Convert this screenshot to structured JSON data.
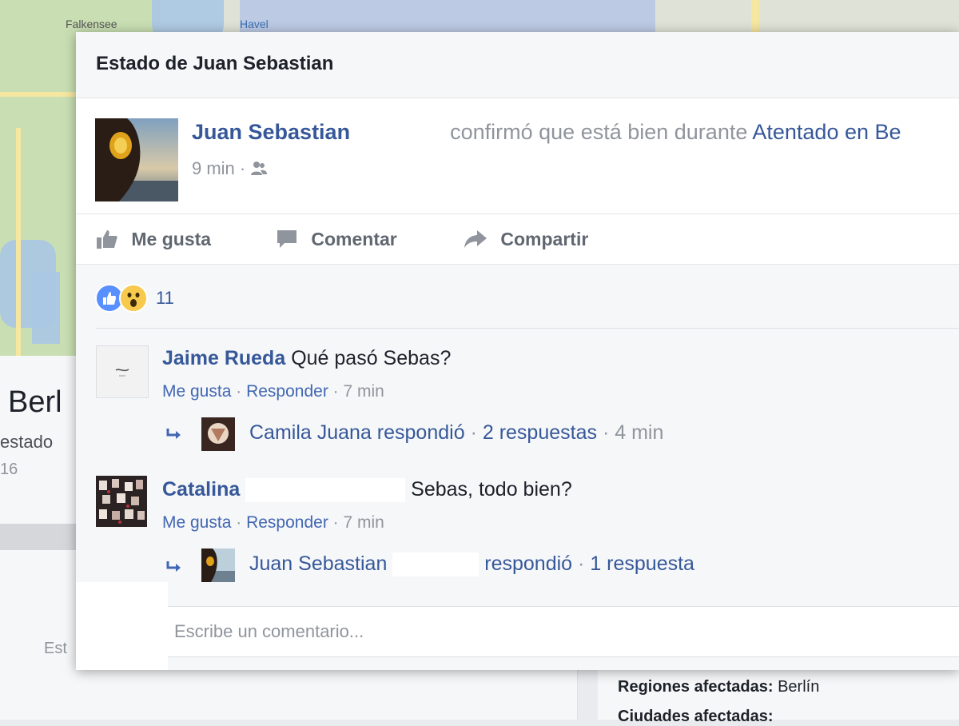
{
  "background": {
    "map_labels": [
      "Falkensee",
      "Havel"
    ],
    "page_title_fragment": "Berl",
    "page_subtitle_fragment": "estado",
    "page_year_fragment": "16",
    "status_button_fragment": "Est",
    "regiones_label": "Regiones afectadas:",
    "regiones_value": "Berlín",
    "ciudades_label": "Ciudades afectadas:"
  },
  "dialog": {
    "title": "Estado de Juan Sebastian",
    "post": {
      "author": "Juan Sebastian",
      "text": "confirmó que está bien durante",
      "event_link": "Atentado en Be",
      "time": "9 min",
      "separator": "·",
      "audience_icon": "friends-icon"
    },
    "actions": {
      "like": "Me gusta",
      "comment": "Comentar",
      "share": "Compartir"
    },
    "reactions": {
      "count": "11",
      "types": [
        "like",
        "wow"
      ]
    },
    "comments": [
      {
        "author": "Jaime Rueda",
        "text": "Qué pasó Sebas?",
        "like": "Me gusta",
        "reply": "Responder",
        "time": "7 min",
        "replies_summary": {
          "name": "Camila Juana respondió",
          "count": "2 respuestas",
          "time": "4 min"
        }
      },
      {
        "author": "Catalina",
        "text": "Sebas, todo bien?",
        "like": "Me gusta",
        "reply": "Responder",
        "time": "7 min",
        "replies_summary": {
          "name": "Juan Sebastian",
          "verb": "respondió",
          "count": "1 respuesta"
        }
      }
    ],
    "composer": {
      "placeholder": "Escribe un comentario..."
    }
  },
  "colors": {
    "link": "#365899",
    "muted": "#90949c",
    "like_blue": "#5890ff",
    "wow_yellow": "#f7c94c"
  }
}
